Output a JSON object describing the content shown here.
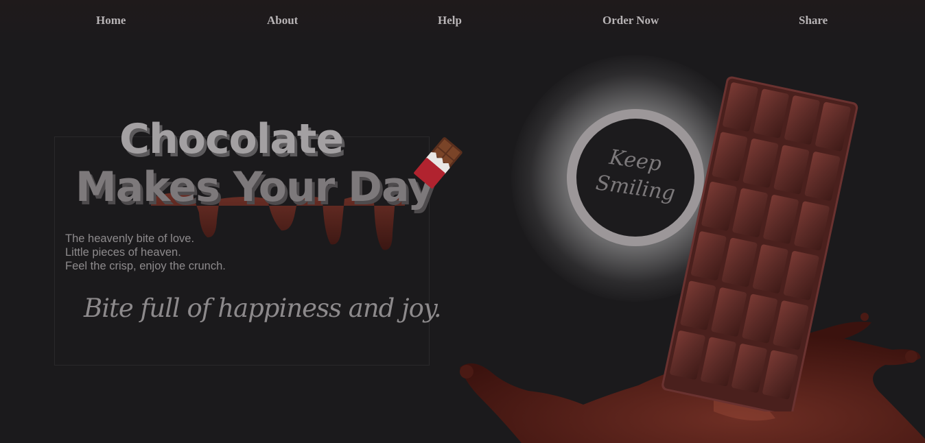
{
  "nav": {
    "items": [
      {
        "label": "Home"
      },
      {
        "label": "About"
      },
      {
        "label": "Help"
      },
      {
        "label": "Order Now"
      },
      {
        "label": "Share"
      }
    ]
  },
  "hero": {
    "title_line1": "Chocolate",
    "title_line2": "Makes Your Day",
    "body_lines": [
      "The heavenly bite of love.",
      "Little pieces of heaven.",
      "Feel the crisp, enjoy the crunch."
    ],
    "tagline": "Bite full of happiness and joy."
  },
  "badge": {
    "line1": "Keep",
    "line2": "Smiling"
  },
  "colors": {
    "background": "#1b1a1c",
    "chocolate": "#5a2a26",
    "wrapper_red": "#b1232f"
  },
  "icons": [
    "chocolate-bar-emoji-icon",
    "chocolate-drip-image",
    "chocolate-bar-image",
    "chocolate-splash-image"
  ]
}
